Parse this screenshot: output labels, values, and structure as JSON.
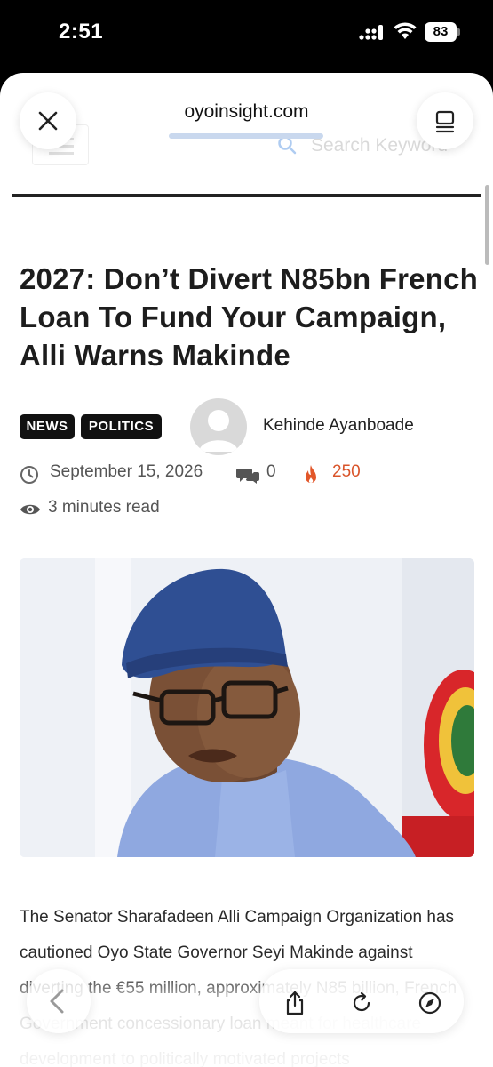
{
  "status_bar": {
    "time": "2:51",
    "battery": "83"
  },
  "browser": {
    "url": "oyoinsight.com",
    "ghost_search_placeholder": "Search Keyword"
  },
  "article": {
    "headline": "2027: Don’t Divert N85bn French Loan To Fund Your Campaign, Alli Warns Makinde",
    "tags": [
      "NEWS",
      "POLITICS"
    ],
    "author": "Kehinde Ayanboade",
    "date": "September 15, 2026",
    "comments": "0",
    "views": "250",
    "read_time": "3 minutes read",
    "body": "The Senator Sharafadeen Alli Campaign Organization has cautioned Oyo State Governor Seyi Makinde against diverting the €55 million, approximately N85 billion, French Government concessionary loan meant for healthcare development to politically motivated projects"
  },
  "colors": {
    "accent_views": "#d9542a",
    "rule": "#222222",
    "tag_bg": "#111111"
  },
  "icons": [
    "close-icon",
    "reader-icon",
    "clock-icon",
    "comment-icon",
    "fire-icon",
    "eye-icon",
    "chevron-left-icon",
    "share-icon",
    "reload-icon",
    "compass-icon"
  ]
}
